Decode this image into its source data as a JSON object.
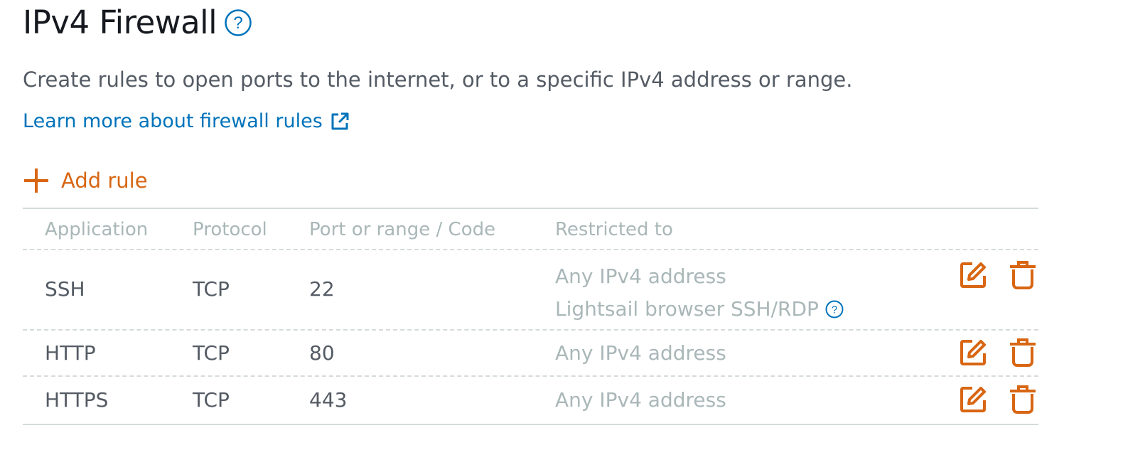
{
  "page": {
    "title": "IPv4 Firewall",
    "description": "Create rules to open ports to the internet, or to a specific IPv4 address or range.",
    "learn_more_link": "Learn more about firewall rules",
    "add_rule_label": "Add rule"
  },
  "table": {
    "columns": [
      "Application",
      "Protocol",
      "Port or range / Code",
      "Restricted to"
    ],
    "rows": [
      {
        "application": "SSH",
        "protocol": "TCP",
        "port": "22",
        "restricted_to": [
          "Any IPv4 address",
          "Lightsail browser SSH/RDP"
        ]
      },
      {
        "application": "HTTP",
        "protocol": "TCP",
        "port": "80",
        "restricted_to": [
          "Any IPv4 address"
        ]
      },
      {
        "application": "HTTPS",
        "protocol": "TCP",
        "port": "443",
        "restricted_to": [
          "Any IPv4 address"
        ]
      }
    ]
  },
  "icons": {
    "title_help": "help-circle-icon",
    "external_link": "external-link-icon",
    "add": "plus-icon",
    "edit": "edit-icon",
    "delete": "trash-icon",
    "inline_help": "help-circle-icon"
  },
  "colors": {
    "link": "#0073bb",
    "accent": "#d86613",
    "text": "#545b64",
    "muted": "#aab7b8",
    "border": "#d5dbdb"
  }
}
